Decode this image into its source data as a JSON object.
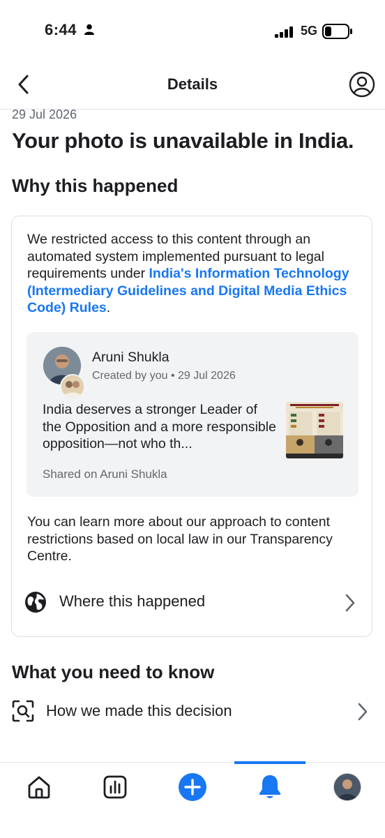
{
  "status_bar": {
    "time": "6:44",
    "network": "5G"
  },
  "header": {
    "title": "Details"
  },
  "notice": {
    "date": "29 Jul 2026",
    "headline": "Your photo is unavailable in India."
  },
  "why": {
    "heading": "Why this happened",
    "explanation_prefix": "We restricted access to this content through an automated system implemented pursuant to legal requirements under ",
    "explanation_link": "India's Information Technology (Intermediary Guidelines and Digital Media Ethics Code) Rules",
    "explanation_suffix": ".",
    "post": {
      "author": "Aruni Shukla",
      "meta": "Created by you • 29 Jul 2026",
      "text": "India deserves a stronger Leader of the Opposition and a more responsible opposition—not who th...",
      "shared": "Shared on Aruni Shukla"
    },
    "learn_more": "You can learn more about our approach to content restrictions based on local law in our Transparency Centre.",
    "where_label": "Where this happened"
  },
  "know": {
    "heading": "What you need to know",
    "decision_label": "How we made this decision"
  },
  "icons": {
    "back": "chevron-left-icon",
    "profile": "user-circle-icon",
    "globe": "globe-icon",
    "scan": "scan-search-icon",
    "home": "home-icon",
    "stats": "bar-chart-icon",
    "create": "plus-circle-icon",
    "notifications": "bell-icon"
  },
  "colors": {
    "accent": "#1877f2",
    "text": "#1c1e21",
    "muted": "#65676b"
  }
}
